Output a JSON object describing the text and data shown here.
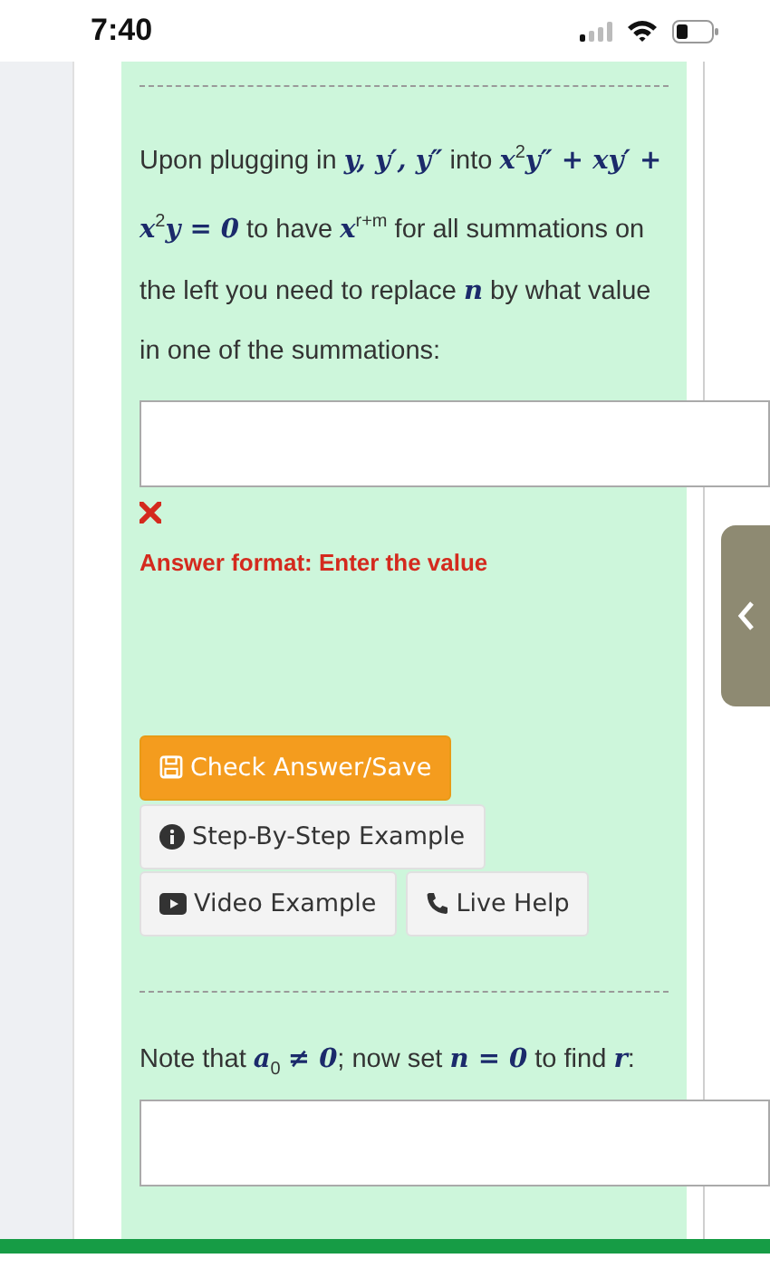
{
  "status_bar": {
    "time": "7:40"
  },
  "question": {
    "prompt": "Upon plugging in *y, y′, y″* into *x*$^{2}$*y″ + xy′ + x*$^{2}$*y = 0* to have *x*$^{r+m}$ for all summations on the left you need to replace *n* by what value in one of the summations:",
    "error_message": "Answer format: Enter the value"
  },
  "buttons": [
    {
      "kind": "save",
      "label": "Check Answer/Save"
    },
    {
      "kind": "step",
      "label": "Step-By-Step Example"
    },
    {
      "kind": "video",
      "label": "Video Example"
    },
    {
      "kind": "help",
      "label": "Live Help"
    }
  ],
  "next_question": {
    "prompt": "Note that *a*$_{0}$ *≠ 0*; now set *n = 0* to find *r*:"
  }
}
